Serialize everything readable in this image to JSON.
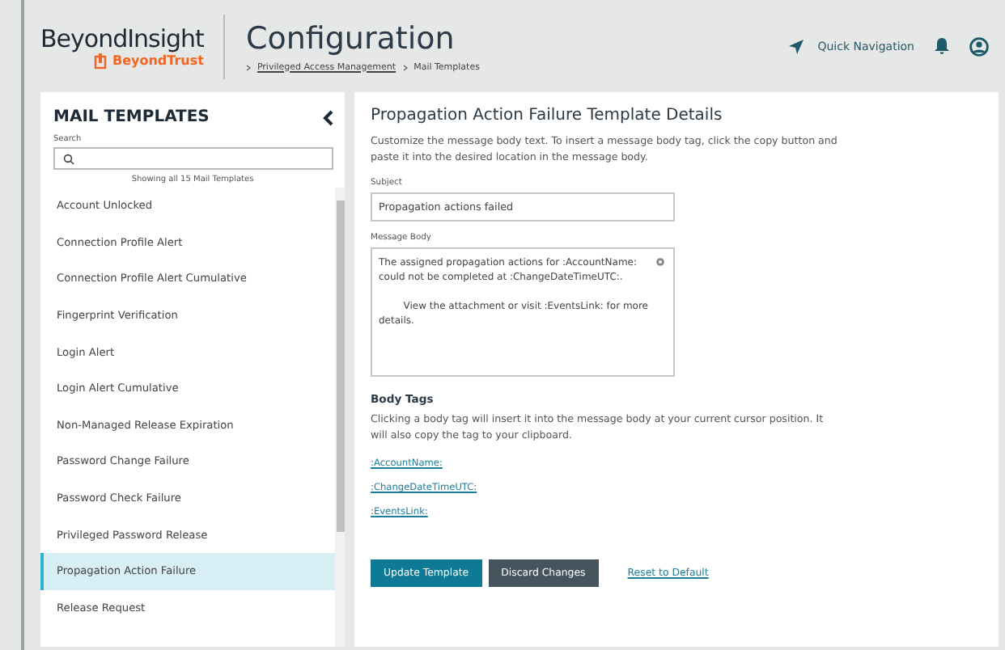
{
  "header": {
    "product": "BeyondInsight",
    "brand": "BeyondTrust",
    "title": "Configuration",
    "breadcrumb": [
      {
        "label": "Privileged Access Management",
        "link": true
      },
      {
        "label": "Mail Templates",
        "link": false
      }
    ],
    "quick_nav": "Quick Navigation"
  },
  "sidebar": {
    "title": "MAIL TEMPLATES",
    "search_label": "Search",
    "count": "Showing all 15 Mail Templates",
    "items": [
      {
        "label": "Account Unlocked",
        "selected": false
      },
      {
        "label": "Connection Profile Alert",
        "selected": false
      },
      {
        "label": "Connection Profile Alert Cumulative",
        "selected": false
      },
      {
        "label": "Fingerprint Verification",
        "selected": false
      },
      {
        "label": "Login Alert",
        "selected": false
      },
      {
        "label": "Login Alert Cumulative",
        "selected": false
      },
      {
        "label": "Non-Managed Release Expiration",
        "selected": false
      },
      {
        "label": "Password Change Failure",
        "selected": false
      },
      {
        "label": "Password Check Failure",
        "selected": false
      },
      {
        "label": "Privileged Password Release",
        "selected": false
      },
      {
        "label": "Propagation Action Failure",
        "selected": true
      },
      {
        "label": "Release Request",
        "selected": false
      }
    ]
  },
  "details": {
    "title": "Propagation Action Failure Template Details",
    "intro": "Customize the message body text. To insert a message body tag, click the copy button and paste it into the desired location in the message body.",
    "subject_label": "Subject",
    "subject": "Propagation actions failed",
    "body_label": "Message Body",
    "body": "The assigned propagation actions for :AccountName: could not be completed at :ChangeDateTimeUTC:.\n\n\t\tView the attachment or visit :EventsLink: for more details.",
    "tags_title": "Body Tags",
    "tags_text": "Clicking a body tag will insert it into the message body at your current cursor position. It will also copy the tag to your clipboard.",
    "tags": [
      ":AccountName:",
      ":ChangeDateTimeUTC:",
      ":EventsLink:"
    ],
    "buttons": [
      {
        "label": "Update Template",
        "kind": "primary"
      },
      {
        "label": "Discard Changes",
        "kind": "secondary"
      },
      {
        "label": "Reset to Default",
        "kind": "link"
      }
    ]
  }
}
